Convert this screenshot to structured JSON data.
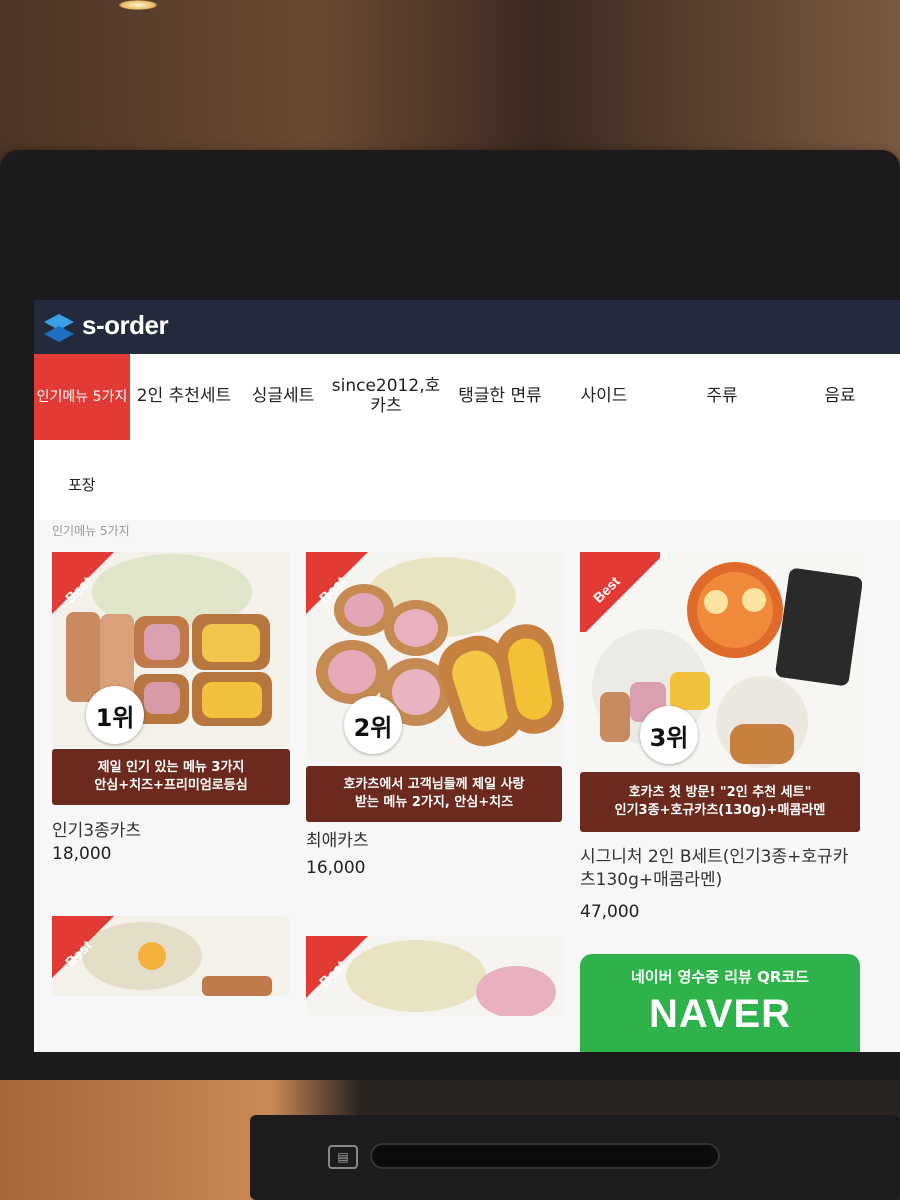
{
  "app": {
    "brand": "s-order"
  },
  "nav": {
    "tabs": [
      {
        "label": "인기메뉴 5가지",
        "active": true
      },
      {
        "label": "2인 추천세트"
      },
      {
        "label": "싱글세트"
      },
      {
        "label": "since2012,호카츠"
      },
      {
        "label": "탱글한 면류"
      },
      {
        "label": "사이드"
      },
      {
        "label": "주류"
      },
      {
        "label": "음료"
      }
    ]
  },
  "packaging": {
    "label": "포장"
  },
  "section": {
    "crumb": "인기메뉴 5가지"
  },
  "products": [
    {
      "badge": "Best",
      "rank": "1위",
      "banner": "제일 인기 있는 메뉴 3가지\n안심+치즈+프리미엄로등심",
      "name": "인기3종카츠",
      "price": "18,000"
    },
    {
      "badge": "Best",
      "rank": "2위",
      "banner": "호카츠에서 고객님들께 제일 사랑\n받는 메뉴 2가지, 안심+치즈",
      "name": "최애카츠",
      "price": "16,000"
    },
    {
      "badge": "Best",
      "rank": "3위",
      "banner": "호카츠 첫 방문! \"2인 추천 세트\"\n인기3종+호규카츠(130g)+매콤라멘",
      "name": "시그니처 2인 B세트(인기3종+호규카츠130g+매콤라멘)",
      "price": "47,000"
    },
    {
      "badge": "Best"
    },
    {
      "badge": "Best"
    }
  ],
  "naver_promo": {
    "subtitle": "네이버 영수증 리뷰 QR코드",
    "title": "NAVER"
  },
  "colors": {
    "header": "#232a3b",
    "accent": "#e23a35",
    "banner": "#6b2a1d",
    "naver": "#2db34a"
  }
}
